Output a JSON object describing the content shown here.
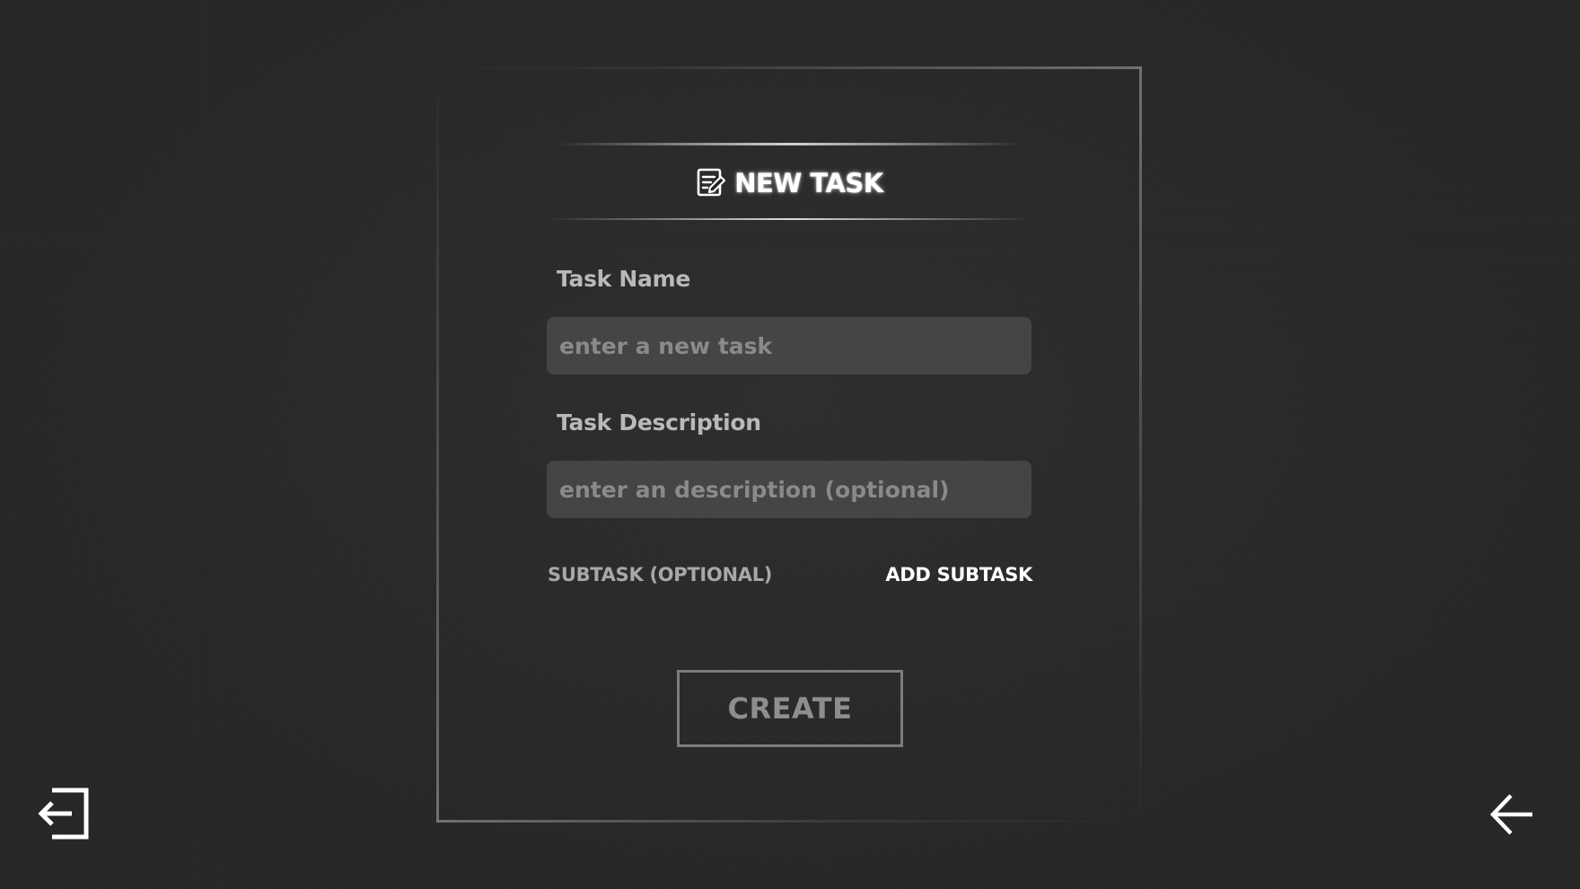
{
  "header": {
    "title": "NEW TASK",
    "icon": "edit-note-icon"
  },
  "form": {
    "task_name": {
      "label": "Task Name",
      "placeholder": "enter a new task",
      "value": ""
    },
    "task_description": {
      "label": "Task Description",
      "placeholder": "enter an description (optional)",
      "value": ""
    },
    "subtask": {
      "label": "SUBTASK (OPTIONAL)",
      "add_label": "ADD SUBTASK"
    },
    "create_label": "CREATE"
  },
  "nav": {
    "logout_icon": "logout-icon",
    "back_icon": "arrow-left-icon"
  },
  "colors": {
    "background": "#232323",
    "text_primary": "#ffffff",
    "text_muted": "#b9b9b9",
    "input_bg": "#4a4a4a",
    "button_border": "#7c7c7c"
  }
}
